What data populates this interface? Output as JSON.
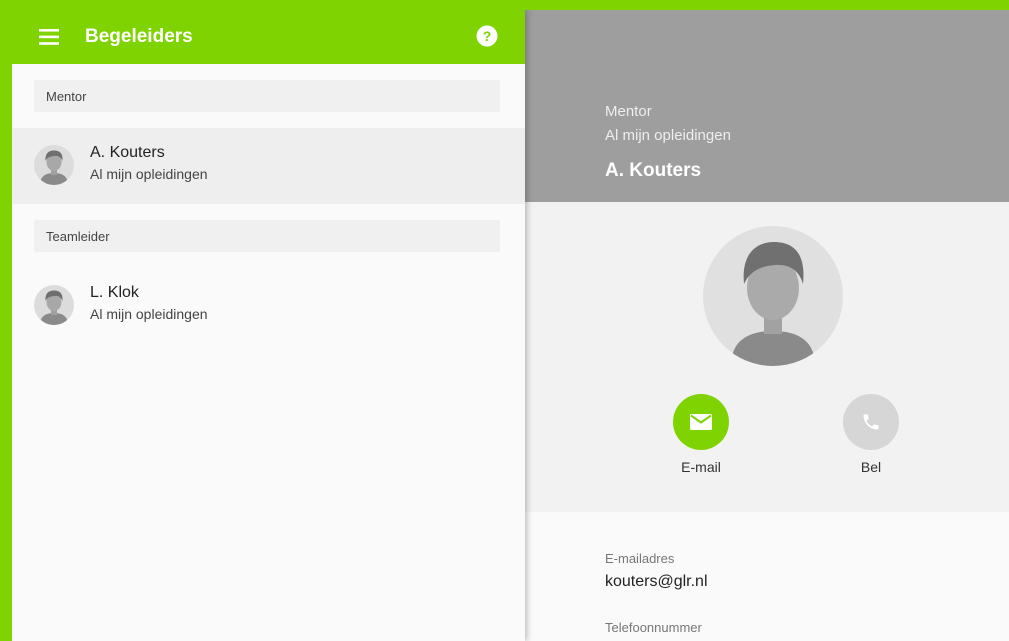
{
  "header": {
    "title": "Begeleiders",
    "menu_icon": "menu-icon",
    "help_icon": "help-icon"
  },
  "colors": {
    "accent": "#7ed300",
    "detail_header": "#9e9e9e",
    "bel_button": "#d6d6d6"
  },
  "sections": [
    {
      "label": "Mentor",
      "contacts": [
        {
          "name": "A. Kouters",
          "subtitle": "Al mijn opleidingen",
          "selected": true
        }
      ]
    },
    {
      "label": "Teamleider",
      "contacts": [
        {
          "name": "L. Klok",
          "subtitle": "Al mijn opleidingen",
          "selected": false
        }
      ]
    }
  ],
  "detail": {
    "role": "Mentor",
    "scope": "Al mijn opleidingen",
    "name": "A. Kouters",
    "actions": {
      "email_label": "E-mail",
      "email_icon": "mail-icon",
      "call_label": "Bel",
      "call_icon": "phone-icon"
    },
    "fields": {
      "email_label": "E-mailadres",
      "email_value": "kouters@glr.nl",
      "phone_label": "Telefoonnummer"
    }
  }
}
